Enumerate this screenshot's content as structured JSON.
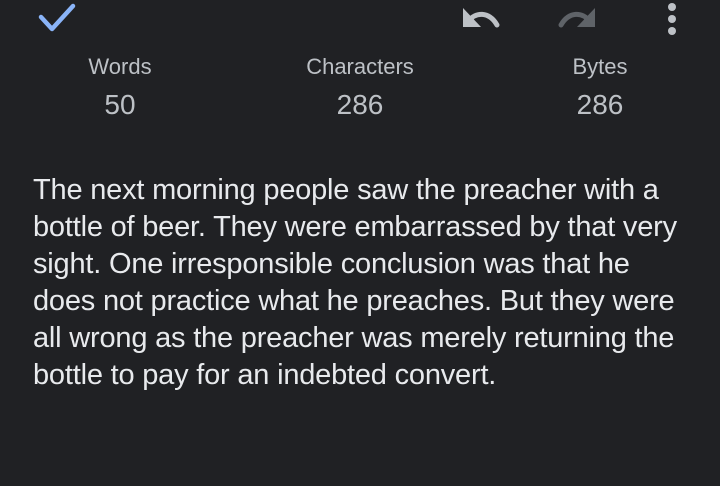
{
  "toolbar": {
    "done_icon": "checkmark-icon",
    "undo_icon": "undo-icon",
    "redo_icon": "redo-icon",
    "more_icon": "more-vertical-icon",
    "accent_color": "#8ab4f8"
  },
  "stats": {
    "words_label": "Words",
    "words_value": "50",
    "characters_label": "Characters",
    "characters_value": "286",
    "bytes_label": "Bytes",
    "bytes_value": "286"
  },
  "document": {
    "text": "The next morning people saw the preacher with a bottle of beer. They were embarrassed by that very sight. One irresponsible conclusion was that he does not practice what he preaches. But they were all wrong as the preacher was merely returning the bottle to pay for an indebted convert."
  }
}
